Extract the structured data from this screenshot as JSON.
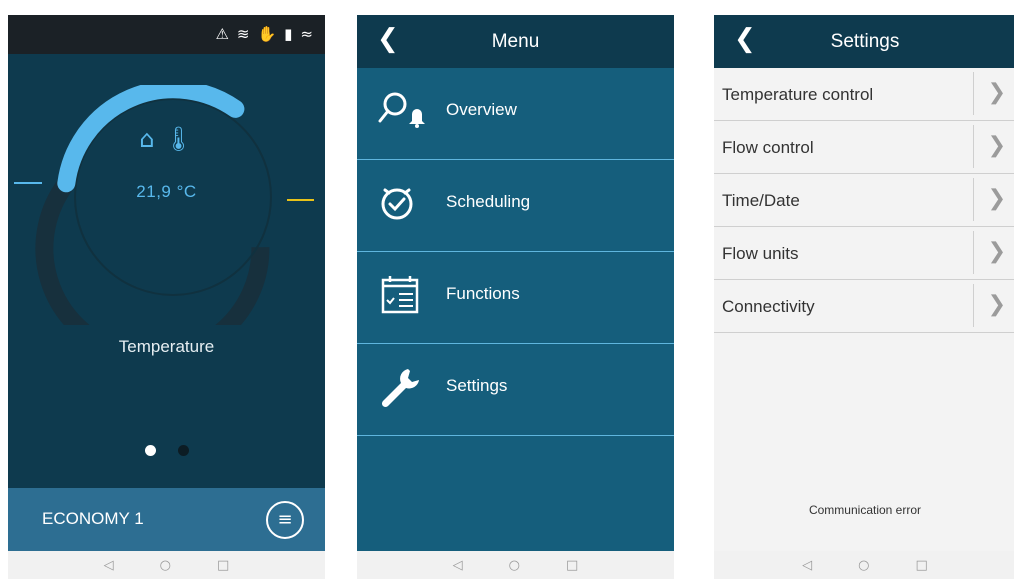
{
  "home": {
    "status_icons": [
      "warning-icon",
      "defrost-icon",
      "hand-icon",
      "suitcase-icon",
      "heat-icon"
    ],
    "temperature_value": "21,9 °C",
    "temperature_label": "Temperature",
    "mode_label": "ECONOMY 1",
    "gauge_fraction": 0.2,
    "colors": {
      "accent": "#58b8ec",
      "setpoint": "#e8c21a",
      "background": "#0e3a4e"
    }
  },
  "menu": {
    "title": "Menu",
    "items": [
      {
        "label": "Overview",
        "icon": "overview-icon"
      },
      {
        "label": "Scheduling",
        "icon": "clock-icon"
      },
      {
        "label": "Functions",
        "icon": "calendar-icon"
      },
      {
        "label": "Settings",
        "icon": "wrench-icon"
      }
    ]
  },
  "settings": {
    "title": "Settings",
    "items": [
      {
        "label": "Temperature control"
      },
      {
        "label": "Flow control"
      },
      {
        "label": "Time/Date"
      },
      {
        "label": "Flow units"
      },
      {
        "label": "Connectivity"
      }
    ],
    "toast": "Communication error"
  },
  "navbar": {
    "icons": [
      "back-nav-icon",
      "home-nav-icon",
      "recents-nav-icon"
    ]
  }
}
